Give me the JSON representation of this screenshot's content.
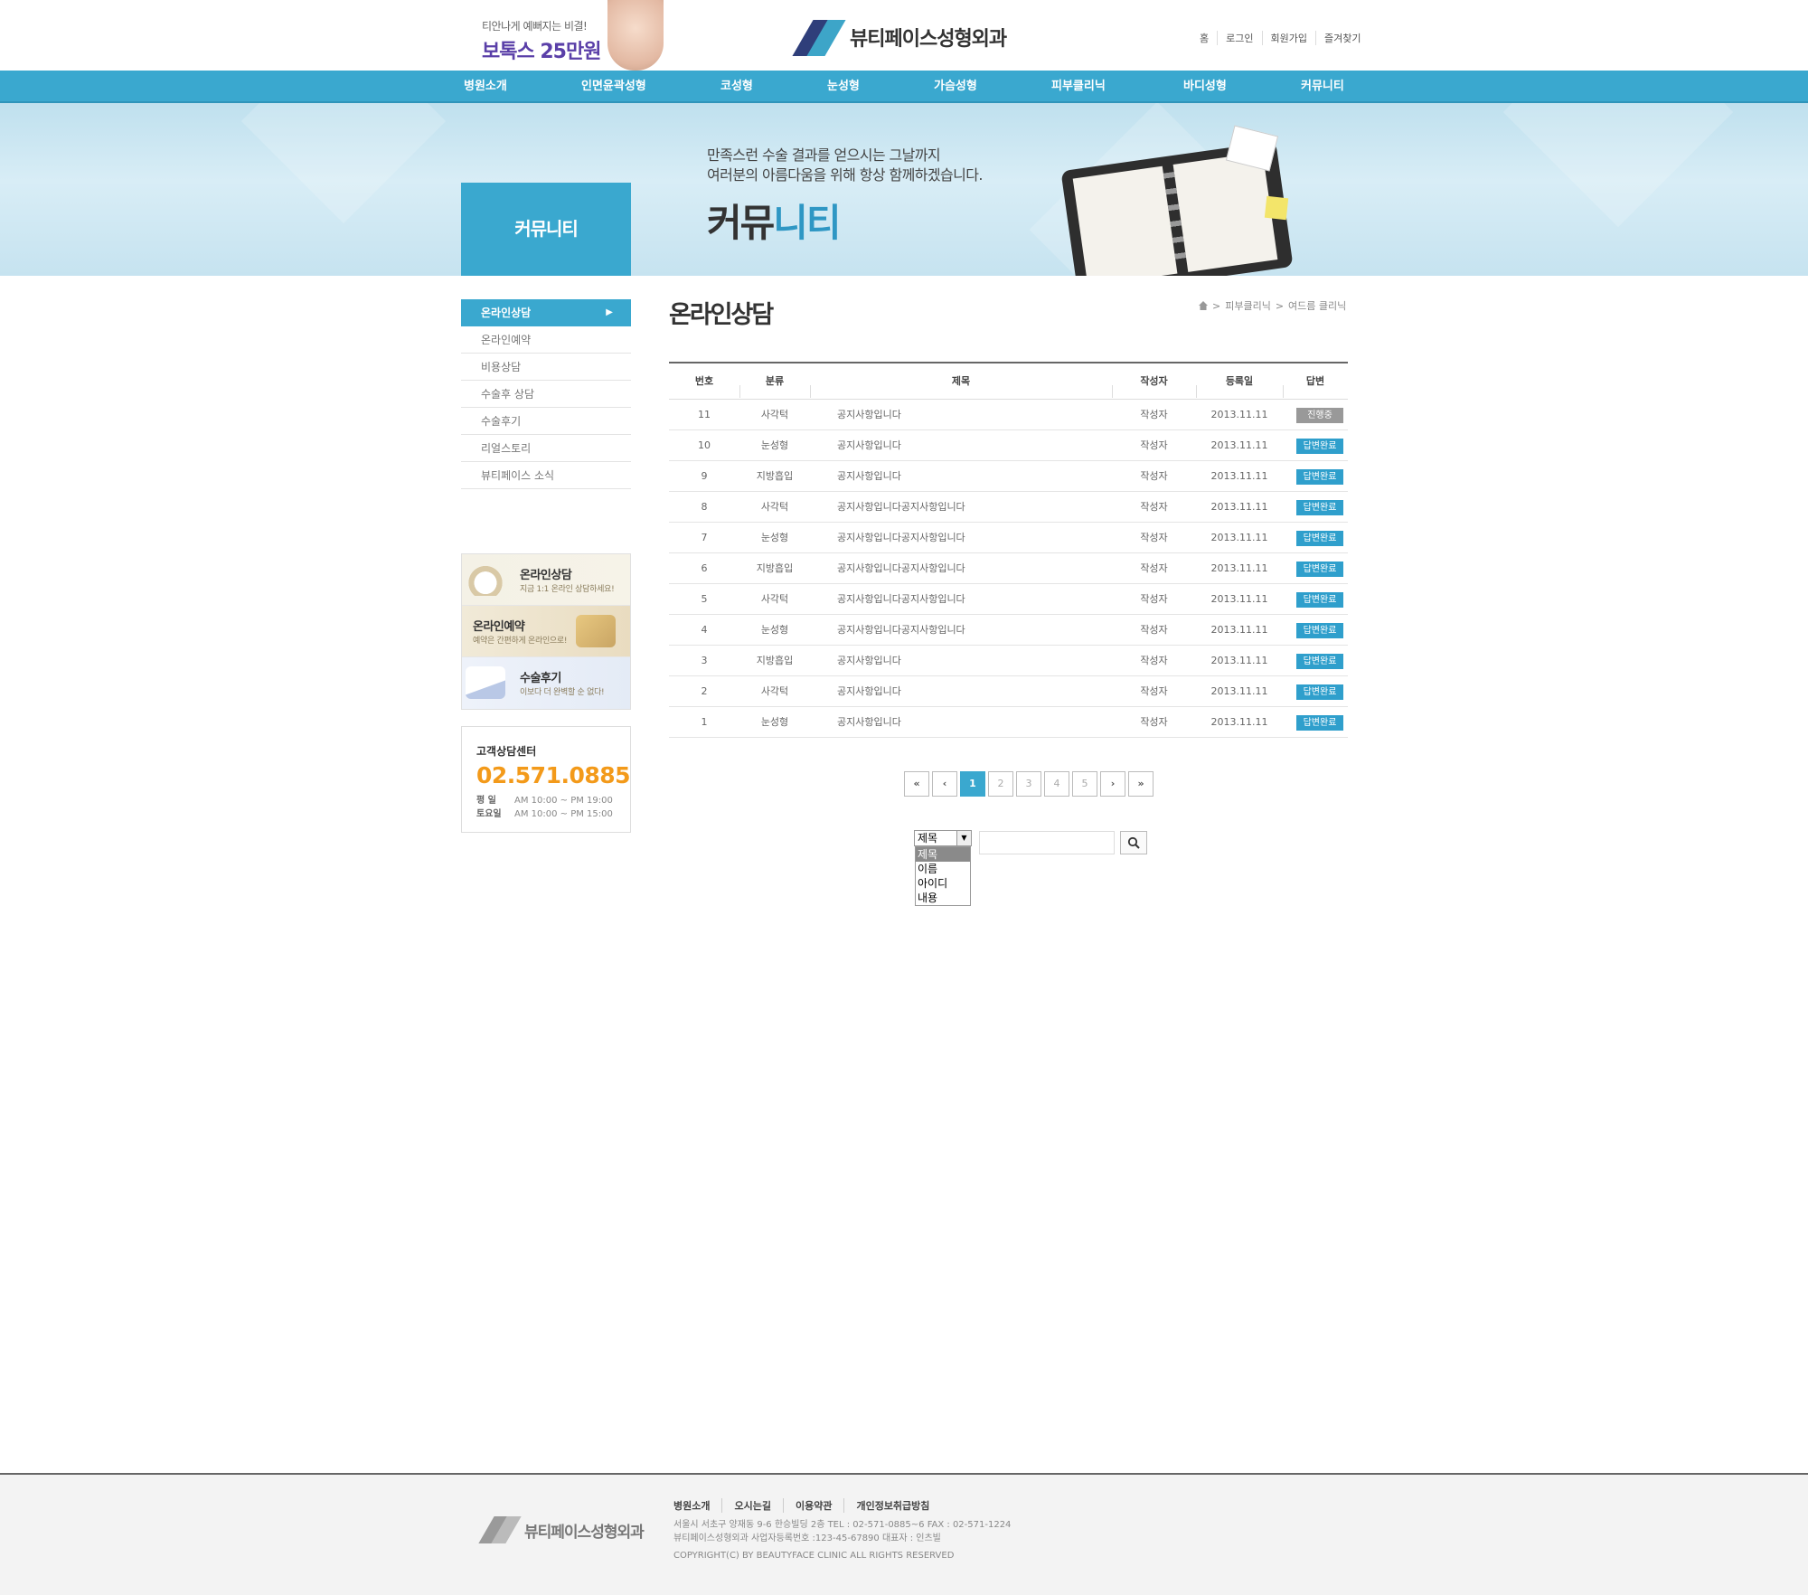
{
  "header": {
    "promo_small": "티안나게 예뻐지는 비결!",
    "promo_big": "보톡스 25만원",
    "logo_text": "뷰티페이스성형외과",
    "util_links": [
      "홈",
      "로그인",
      "회원가입",
      "즐겨찾기"
    ]
  },
  "gnb": [
    "병원소개",
    "인면윤곽성형",
    "코성형",
    "눈성형",
    "가슴성형",
    "피부클리닉",
    "바디성형",
    "커뮤니티"
  ],
  "visual": {
    "line1": "만족스런 수술 결과를 얻으시는 그날까지",
    "line2": "여러분의 아름다움을 위해 항상 함께하겠습니다.",
    "title_a": "커뮤",
    "title_b": "니티",
    "lnb_title": "커뮤니티"
  },
  "lnb": [
    "온라인상담",
    "온라인예약",
    "비용상담",
    "수술후 상담",
    "수술후기",
    "리얼스토리",
    "뷰티페이스 소식"
  ],
  "quick_banners": [
    {
      "title": "온라인상담",
      "sub": "지금 1:1 온라인 상담하세요!"
    },
    {
      "title": "온라인예약",
      "sub": "예약은 간편하게 온라인으로!"
    },
    {
      "title": "수술후기",
      "sub": "이보다 더 완벽할 순 없다!"
    }
  ],
  "cs": {
    "label": "고객상담센터",
    "tel": "02.571.0885",
    "weekday_label": "평  일",
    "weekday_hours": "AM 10:00 ~ PM 19:00",
    "sat_label": "토요일",
    "sat_hours": "AM 10:00 ~ PM 15:00"
  },
  "content": {
    "page_title": "온라인상담",
    "breadcrumb": [
      "피부클리닉",
      "여드름 클리닉"
    ]
  },
  "board": {
    "headers": [
      "번호",
      "분류",
      "제목",
      "작성자",
      "등록일",
      "답변"
    ],
    "rows": [
      {
        "no": "11",
        "cat": "사각턱",
        "subject": "공지사항입니다",
        "writer": "작성자",
        "date": "2013.11.11",
        "answer": "진행중",
        "status": "prog"
      },
      {
        "no": "10",
        "cat": "눈성형",
        "subject": "공지사항입니다",
        "writer": "작성자",
        "date": "2013.11.11",
        "answer": "답변완료",
        "status": "done"
      },
      {
        "no": "9",
        "cat": "지방흡입",
        "subject": "공지사항입니다",
        "writer": "작성자",
        "date": "2013.11.11",
        "answer": "답변완료",
        "status": "done"
      },
      {
        "no": "8",
        "cat": "사각턱",
        "subject": "공지사항입니다공지사항입니다",
        "writer": "작성자",
        "date": "2013.11.11",
        "answer": "답변완료",
        "status": "done"
      },
      {
        "no": "7",
        "cat": "눈성형",
        "subject": "공지사항입니다공지사항입니다",
        "writer": "작성자",
        "date": "2013.11.11",
        "answer": "답변완료",
        "status": "done"
      },
      {
        "no": "6",
        "cat": "지방흡입",
        "subject": "공지사항입니다공지사항입니다",
        "writer": "작성자",
        "date": "2013.11.11",
        "answer": "답변완료",
        "status": "done"
      },
      {
        "no": "5",
        "cat": "사각턱",
        "subject": "공지사항입니다공지사항입니다",
        "writer": "작성자",
        "date": "2013.11.11",
        "answer": "답변완료",
        "status": "done"
      },
      {
        "no": "4",
        "cat": "눈성형",
        "subject": "공지사항입니다공지사항입니다",
        "writer": "작성자",
        "date": "2013.11.11",
        "answer": "답변완료",
        "status": "done"
      },
      {
        "no": "3",
        "cat": "지방흡입",
        "subject": "공지사항입니다",
        "writer": "작성자",
        "date": "2013.11.11",
        "answer": "답변완료",
        "status": "done"
      },
      {
        "no": "2",
        "cat": "사각턱",
        "subject": "공지사항입니다",
        "writer": "작성자",
        "date": "2013.11.11",
        "answer": "답변완료",
        "status": "done"
      },
      {
        "no": "1",
        "cat": "눈성형",
        "subject": "공지사항입니다",
        "writer": "작성자",
        "date": "2013.11.11",
        "answer": "답변완료",
        "status": "done"
      }
    ]
  },
  "paging": {
    "first": "«",
    "prev": "‹",
    "next": "›",
    "last": "»",
    "pages": [
      "1",
      "2",
      "3",
      "4",
      "5"
    ],
    "current": "1"
  },
  "search": {
    "selected": "제목",
    "options": [
      "제목",
      "이름",
      "아이디",
      "내용"
    ],
    "keyword": ""
  },
  "footer": {
    "logo_text": "뷰티페이스성형외과",
    "links": [
      "병원소개",
      "오시는길",
      "이용약관",
      "개인정보취급방침"
    ],
    "addr": "서울시 서초구 양재동 9-6  한승빌딩 2층  TEL : 02-571-0885~6  FAX : 02-571-1224",
    "biz": "뷰티페이스성형외과  사업자등록번호 :123-45-67890  대표자 : 인츠빌",
    "copyright": "COPYRIGHT(C) BY BEAUTYFACE CLINIC ALL RIGHTS RESERVED"
  },
  "colors": {
    "accent": "#3aa8cf",
    "tel": "#f39a1a",
    "progress_badge": "#999999"
  }
}
